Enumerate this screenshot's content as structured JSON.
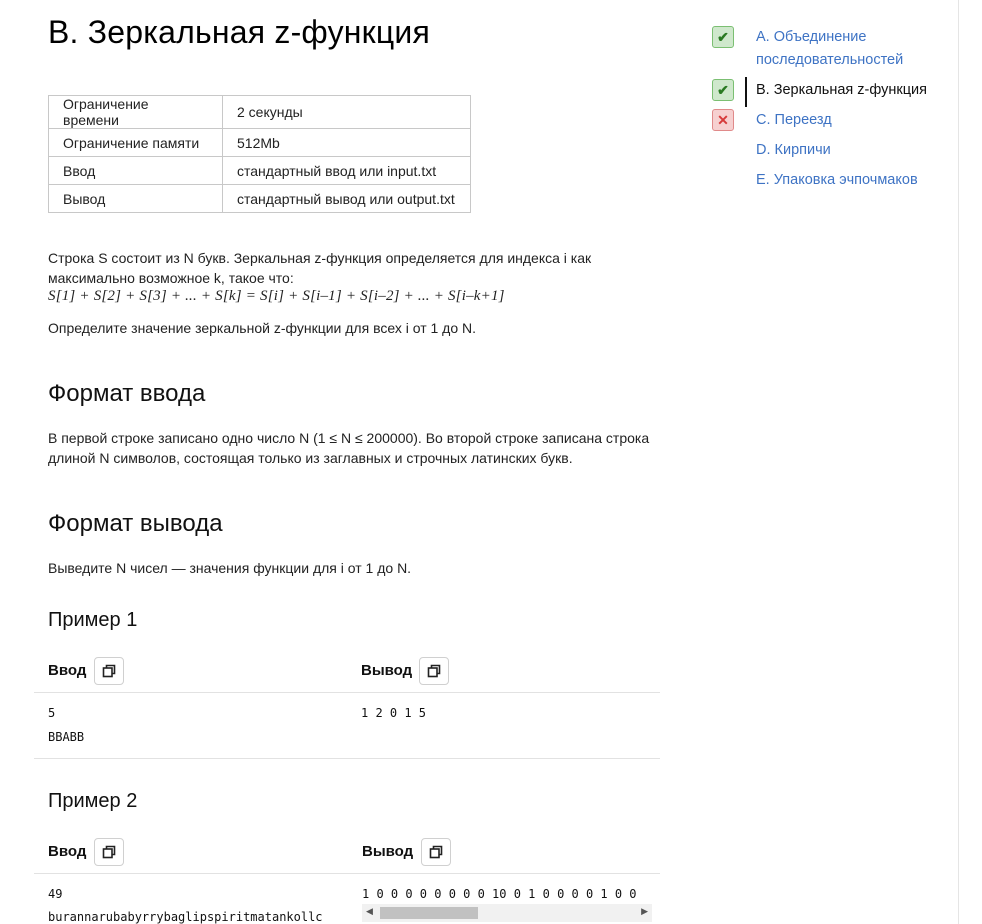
{
  "problem": {
    "title": "B. Зеркальная z-функция",
    "limits": [
      {
        "key": "Ограничение времени",
        "value": "2 секунды"
      },
      {
        "key": "Ограничение памяти",
        "value": "512Mb"
      },
      {
        "key": "Ввод",
        "value": "стандартный ввод или input.txt"
      },
      {
        "key": "Вывод",
        "value": "стандартный вывод или output.txt"
      }
    ],
    "statement_line1": "Строка S состоит из N букв. Зеркальная z-функция определяется для индекса i как",
    "statement_line2": "максимально возможное k, такое что:",
    "formula": "S[1] + S[2] + S[3] + ... + S[k] = S[i] + S[i–1] + S[i–2] + ... + S[i–k+1]",
    "task": "Определите значение зеркальной z-функции для всех i от 1 до N.",
    "input_heading": "Формат ввода",
    "input_line1": "В первой строке записано одно число N (1 ≤ N ≤ 200000). Во второй строке записана строка",
    "input_line2": "длиной N символов, состоящая только из заглавных и строчных латинских букв.",
    "output_heading": "Формат вывода",
    "output_text": "Выведите N чисел — значения функции для i от 1 до N."
  },
  "examples": [
    {
      "title": "Пример 1",
      "input_label": "Ввод",
      "output_label": "Вывод",
      "input_lines": [
        "5",
        "BBABB"
      ],
      "output_lines": [
        "1 2 0 1 5"
      ]
    },
    {
      "title": "Пример 2",
      "input_label": "Ввод",
      "output_label": "Вывод",
      "input_lines": [
        "49",
        "burannarubabyrrybaglipspiritmatankollc"
      ],
      "output_lines": [
        "1 0 0 0 0 0 0 0 0 10 0 1 0 0 0 0 1 0 0"
      ]
    }
  ],
  "sidebar": {
    "items": [
      {
        "status": "ok",
        "icon": "checkmark-icon",
        "label_line1": "A. Объединение",
        "label_line2": "последовательностей"
      },
      {
        "status": "ok",
        "icon": "checkmark-icon",
        "label_line1": "B. Зеркальная z-функция",
        "active": true
      },
      {
        "status": "fail",
        "icon": "cross-icon",
        "label_line1": "C. Переезд"
      },
      {
        "status": "none",
        "label_line1": "D. Кирпичи"
      },
      {
        "status": "none",
        "label_line1": "E. Упаковка эчпочмаков"
      }
    ]
  },
  "colors": {
    "link": "#3e73c4",
    "ok": "#2a7a22",
    "fail": "#d63a3a"
  }
}
